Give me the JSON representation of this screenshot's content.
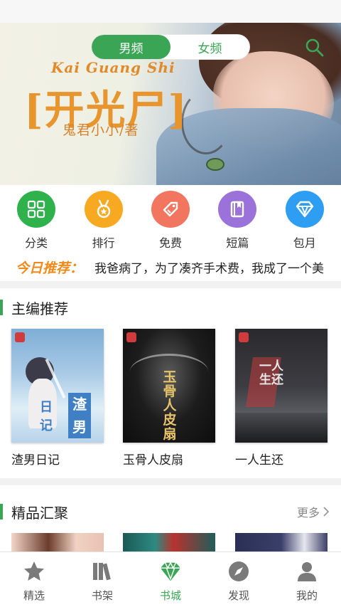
{
  "banner": {
    "title_en": "Kai Guang Shi",
    "title_cn": "[开光尸]",
    "author": "鬼君小小/著",
    "gender_tabs": [
      {
        "label": "男频",
        "active": true
      },
      {
        "label": "女频",
        "active": false
      }
    ],
    "slide_index": 1,
    "slide_count": 2
  },
  "categories": [
    {
      "label": "分类",
      "icon": "grid-icon",
      "color": "#2fb24c"
    },
    {
      "label": "排行",
      "icon": "medal-icon",
      "color": "#f7a921"
    },
    {
      "label": "免费",
      "icon": "tag-icon",
      "color": "#f27560"
    },
    {
      "label": "短篇",
      "icon": "book-icon",
      "color": "#9b72d9"
    },
    {
      "label": "包月",
      "icon": "diamond-icon",
      "color": "#2e9ef2"
    }
  ],
  "today": {
    "tag": "今日推荐：",
    "text": "我爸病了，为了凑齐手术费，我成了一个美"
  },
  "editor_section": {
    "title": "主编推荐",
    "books": [
      {
        "title": "渣男日记"
      },
      {
        "title": "玉骨人皮扇"
      },
      {
        "title": "一人生还"
      }
    ]
  },
  "featured_section": {
    "title": "精品汇聚",
    "more": "更多"
  },
  "covers": {
    "book1_big_a": "渣",
    "book1_big_b": "男",
    "book1_big_c": "日",
    "book1_big_d": "记",
    "book2_title": "玉骨人皮扇",
    "book3_title": "一人生还"
  },
  "tabbar": [
    {
      "label": "精选",
      "icon": "star-icon",
      "active": false
    },
    {
      "label": "书架",
      "icon": "bookshelf-icon",
      "active": false
    },
    {
      "label": "书城",
      "icon": "gem-icon",
      "active": true
    },
    {
      "label": "发现",
      "icon": "compass-icon",
      "active": false
    },
    {
      "label": "我的",
      "icon": "user-icon",
      "active": false
    }
  ],
  "colors": {
    "accent": "#3aa655",
    "today_tag": "#f08a1c"
  }
}
